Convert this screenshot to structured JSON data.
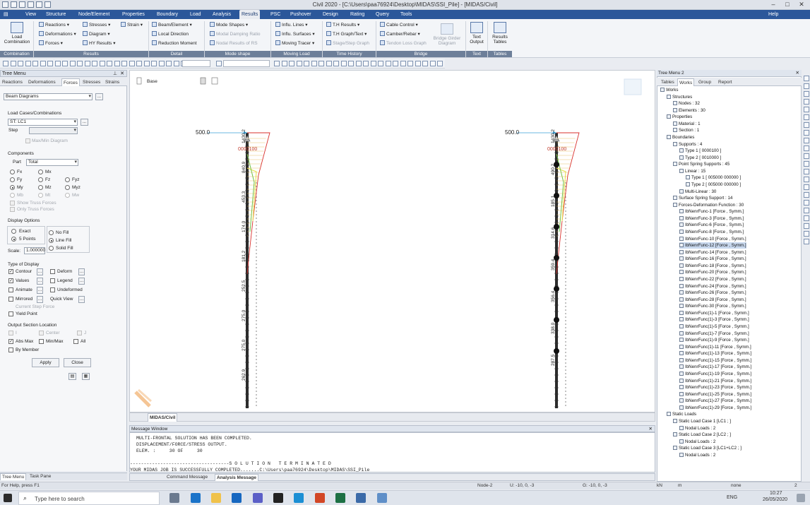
{
  "window": {
    "title": "Civil 2020 - [C:\\Users\\paa76924\\Desktop\\MIDAS\\SSI_Pile] - [MIDAS/Civil]"
  },
  "menu": [
    "View",
    "Structure",
    "Node/Element",
    "Properties",
    "Boundary",
    "Load",
    "Analysis",
    "Results",
    "PSC",
    "Pushover",
    "Design",
    "Rating",
    "Query",
    "Tools"
  ],
  "menu_right": {
    "help": "Help"
  },
  "ribbon": {
    "load_combination": "Load\nCombination",
    "reactions": "Reactions",
    "deformations": "Deformations",
    "forces": "Forces",
    "stresses": "Stresses",
    "diagram": "Diagram",
    "hy_results": "HY Results",
    "strain": "Strain",
    "beam_element": "Beam/Element",
    "local_direction": "Local Direction",
    "reduction_moment": "Reduction Moment",
    "mode_shapes": "Mode Shapes",
    "modal_damping": "Modal Damping Ratio",
    "nodal_results": "Nodal Results of RS",
    "influ_lines": "Influ. Lines",
    "influ_surfaces": "Influ. Surfaces",
    "moving_tracer": "Moving Tracer",
    "th_results": "T.H Results",
    "th_graph": "T.H Graph/Text",
    "stage_graph": "Stage/Step Graph",
    "cable_control": "Cable Control",
    "camber_rebar": "Camber/Rebar",
    "tendon_loss": "Tendon Loss Graph",
    "bridge_girder": "Bridge Girder\nDiagram",
    "text_output": "Text\nOutput",
    "results_tables": "Results\nTables",
    "groups": [
      "Combination",
      "Results",
      "Detail",
      "Mode shape",
      "Moving Load",
      "Time History",
      "Bridge",
      "Text",
      "Tables"
    ]
  },
  "left": {
    "title": "Tree Menu",
    "tabs": [
      "Reactions",
      "Deformations",
      "Forces",
      "Stresses",
      "Strains"
    ],
    "diagram_type": "Beam Diagrams",
    "load_cases_label": "Load Cases/Combinations",
    "load_case": "ST: LC1",
    "step_label": "Step",
    "maxmin": "Max/Min Diagram",
    "components_label": "Components",
    "part_label": "Part",
    "part_value": "Total",
    "components": [
      "Fx",
      "Mx",
      "Fy",
      "Fz",
      "Fyz",
      "My",
      "Mz",
      "Myz",
      "Mb",
      "Mt",
      "Mw"
    ],
    "show_truss": "Show Truss Forces",
    "only_truss": "Only Truss Forces",
    "display_options_label": "Display Options",
    "exact": "Exact",
    "five_points": "5 Points",
    "no_fill": "No Fill",
    "line_fill": "Line Fill",
    "solid_fill": "Solid Fill",
    "scale_label": "Scale:",
    "scale_value": "1.000000",
    "type_display_label": "Type of Display",
    "contour": "Contour",
    "deform": "Deform",
    "values": "Values",
    "legend": "Legend",
    "animate": "Animate",
    "undeformed": "Undeformed",
    "mirrored": "Mirrored",
    "quick_view": "Quick View",
    "current_step": "Current Step Force",
    "yield_point": "Yield Point",
    "output_section_label": "Output Section Location",
    "sec_i": "I",
    "sec_center": "Center",
    "sec_j": "J",
    "abs_max": "Abs Max",
    "min_max": "Min/Max",
    "all": "All",
    "by_member": "By Member",
    "apply": "Apply",
    "close": "Close",
    "bottom_tabs": [
      "Tree Menu",
      "Task Pane"
    ]
  },
  "canvas": {
    "view_label": "Base",
    "tab": "MIDAS/Civil",
    "left_pile": {
      "top_value": "500.0",
      "node_label": "0000100",
      "labels": [
        "1430.2",
        "840.9",
        "453.3",
        "174.0",
        "181.2",
        "252.5",
        "275.0",
        "275.0",
        "262.9"
      ]
    },
    "right_pile": {
      "top_value": "500.0",
      "node_label": "0000100",
      "labels": [
        "1430.2",
        "490.2",
        "185.1",
        "314.6",
        "359.4",
        "356.4",
        "338.0",
        "287.5"
      ]
    }
  },
  "messages": {
    "title": "Message Window",
    "lines": [
      "MULTI-FRONTAL SOLUTION HAS BEEN COMPLETED.",
      "DISPLACEMENT/FORCE/STRESS OUTPUT.",
      "ELEM. :     30 OF     30",
      "------------------------------------S O L U T I O N   T E R M I N A T E D",
      "YOUR MIDAS JOB IS SUCCESSFULLY COMPLETED.......C:\\Users\\paa76924\\Desktop\\MIDAS\\SSI_Pile"
    ],
    "tabs": [
      "Command Message",
      "Analysis Message"
    ]
  },
  "right": {
    "title": "Tree Menu 2",
    "tabs": [
      "Tables",
      "Works",
      "Group",
      "Report"
    ],
    "items": [
      {
        "t": "Works",
        "d": 0
      },
      {
        "t": "Structures",
        "d": 1
      },
      {
        "t": "Nodes : 32",
        "d": 2
      },
      {
        "t": "Elements : 30",
        "d": 2
      },
      {
        "t": "Properties",
        "d": 1
      },
      {
        "t": "Material : 1",
        "d": 2
      },
      {
        "t": "Section : 1",
        "d": 2
      },
      {
        "t": "Boundaries",
        "d": 1
      },
      {
        "t": "Supports : 4",
        "d": 2
      },
      {
        "t": "Type 1 [ 0000100 ]",
        "d": 3
      },
      {
        "t": "Type 2 [ 0010000 ]",
        "d": 3
      },
      {
        "t": "Point Spring Supports : 45",
        "d": 2
      },
      {
        "t": "Linear : 15",
        "d": 3
      },
      {
        "t": "Type 1 [ 005000 000000 ]",
        "d": 4
      },
      {
        "t": "Type 2 [ 005000 000000 ]",
        "d": 4
      },
      {
        "t": "Multi-Linear : 30",
        "d": 3
      },
      {
        "t": "Surface Spring Support : 14",
        "d": 2
      },
      {
        "t": "Forces-Deformation Function : 30",
        "d": 2
      },
      {
        "t": "IbNenrFunc-1 [Force , Symm.]",
        "d": 3
      },
      {
        "t": "IbNenrFunc-3 [Force , Symm.]",
        "d": 3
      },
      {
        "t": "IbNenrFunc-6 [Force , Symm.]",
        "d": 3
      },
      {
        "t": "IbNenrFunc-8 [Force , Symm.]",
        "d": 3
      },
      {
        "t": "IbNenrFunc-10 [Force , Symm.]",
        "d": 3
      },
      {
        "t": "IbNenrFunc-12 [Force , Symm.]",
        "d": 3,
        "hl": true
      },
      {
        "t": "IbNenrFunc-14 [Force , Symm.]",
        "d": 3
      },
      {
        "t": "IbNenrFunc-16 [Force , Symm.]",
        "d": 3
      },
      {
        "t": "IbNenrFunc-18 [Force , Symm.]",
        "d": 3
      },
      {
        "t": "IbNenrFunc-20 [Force , Symm.]",
        "d": 3
      },
      {
        "t": "IbNenrFunc-22 [Force , Symm.]",
        "d": 3
      },
      {
        "t": "IbNenrFunc-24 [Force , Symm.]",
        "d": 3
      },
      {
        "t": "IbNenrFunc-26 [Force , Symm.]",
        "d": 3
      },
      {
        "t": "IbNenrFunc-28 [Force , Symm.]",
        "d": 3
      },
      {
        "t": "IbNenrFunc-30 [Force , Symm.]",
        "d": 3
      },
      {
        "t": "IbNenrFunc(1)-1 [Force , Symm.]",
        "d": 3
      },
      {
        "t": "IbNenrFunc(1)-3 [Force , Symm.]",
        "d": 3
      },
      {
        "t": "IbNenrFunc(1)-5 [Force , Symm.]",
        "d": 3
      },
      {
        "t": "IbNenrFunc(1)-7 [Force , Symm.]",
        "d": 3
      },
      {
        "t": "IbNenrFunc(1)-9 [Force , Symm.]",
        "d": 3
      },
      {
        "t": "IbNenrFunc(1)-11 [Force , Symm.]",
        "d": 3
      },
      {
        "t": "IbNenrFunc(1)-13 [Force , Symm.]",
        "d": 3
      },
      {
        "t": "IbNenrFunc(1)-15 [Force , Symm.]",
        "d": 3
      },
      {
        "t": "IbNenrFunc(1)-17 [Force , Symm.]",
        "d": 3
      },
      {
        "t": "IbNenrFunc(1)-19 [Force , Symm.]",
        "d": 3
      },
      {
        "t": "IbNenrFunc(1)-21 [Force , Symm.]",
        "d": 3
      },
      {
        "t": "IbNenrFunc(1)-23 [Force , Symm.]",
        "d": 3
      },
      {
        "t": "IbNenrFunc(1)-25 [Force , Symm.]",
        "d": 3
      },
      {
        "t": "IbNenrFunc(1)-27 [Force , Symm.]",
        "d": 3
      },
      {
        "t": "IbNenrFunc(1)-29 [Force , Symm.]",
        "d": 3
      },
      {
        "t": "Static Loads",
        "d": 1
      },
      {
        "t": "Static Load Case 1 [LC1 ; ]",
        "d": 2
      },
      {
        "t": "Nodal Loads : 2",
        "d": 3
      },
      {
        "t": "Static Load Case 2 [LC2 ; ]",
        "d": 2
      },
      {
        "t": "Nodal Loads : 2",
        "d": 3
      },
      {
        "t": "Static Load Case 3 [LC1+LC2 ; ]",
        "d": 2
      },
      {
        "t": "Nodal Loads : 2",
        "d": 3
      }
    ]
  },
  "status": {
    "help": "For Help, press F1",
    "node": "Node-2",
    "u": "U: -10, 0, -3",
    "g": "G: -10, 0, -3",
    "unit1": "kN",
    "unit2": "m",
    "none": "none",
    "page": "2"
  },
  "taskbar": {
    "search": "Type here to search",
    "lang": "ENG",
    "time": "10:27",
    "date": "26/05/2020"
  },
  "colors": {
    "accent": "#2b579a",
    "diagram_green": "#6cc24a",
    "diagram_yellow": "#e8e04a",
    "diagram_red": "#d9302c",
    "pile": "#2c2c2c"
  }
}
